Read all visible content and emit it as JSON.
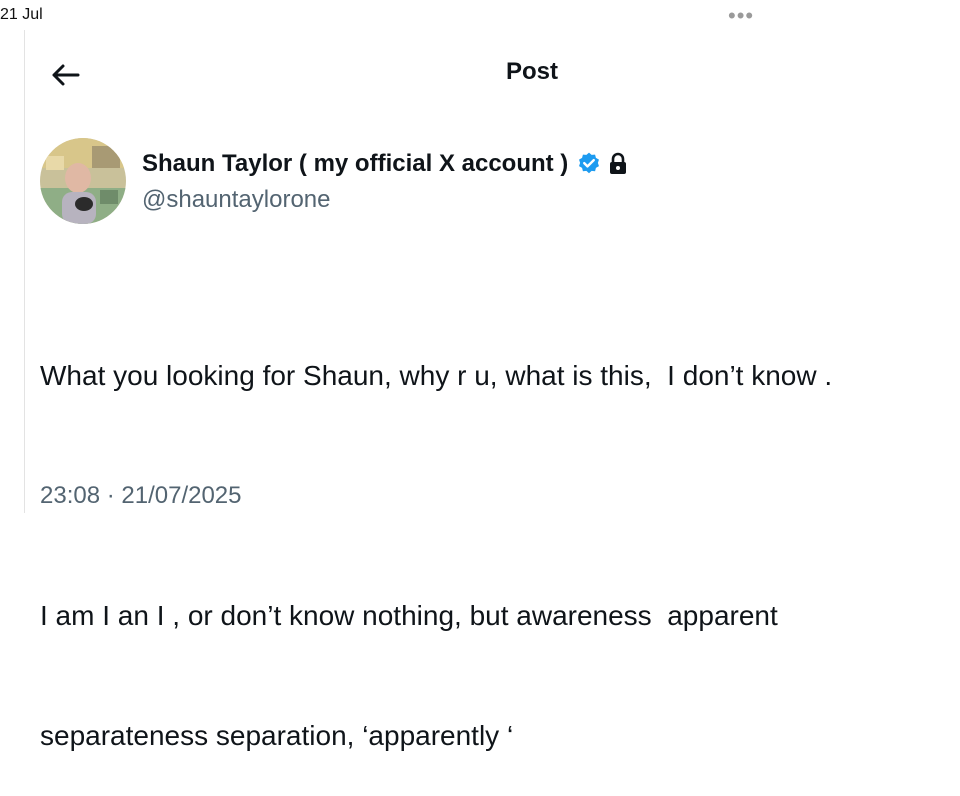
{
  "status_bar": {
    "date": "21 Jul"
  },
  "header": {
    "title": "Post",
    "back_icon": "arrow-left-icon",
    "more_icon": "more-dots-icon"
  },
  "author": {
    "display_name": "Shaun Taylor ( my official X account )",
    "handle": "@shauntaylorone",
    "verified_color": "#1d9bf0",
    "protected": true
  },
  "post": {
    "line1": "What you looking for Shaun, why r u, what is this,  I don’t know .",
    "line2": "I am I an I , or don’t know nothing, but awareness  apparent",
    "line3": "separateness separation, ‘apparently ‘",
    "timestamp": "23:08 · 21/07/2025"
  }
}
